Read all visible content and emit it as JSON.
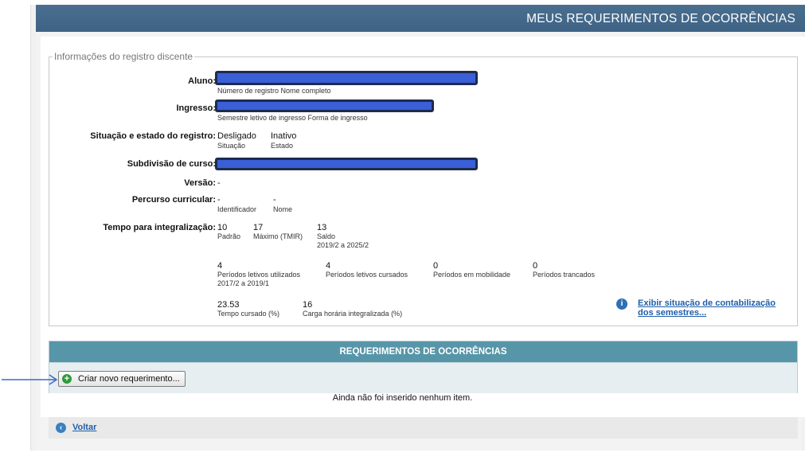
{
  "header": {
    "title": "MEUS REQUERIMENTOS DE OCORRÊNCIAS"
  },
  "registro": {
    "legend": "Informações do registro discente",
    "aluno": {
      "label": "Aluno:",
      "sub": "Número de registro   Nome completo"
    },
    "ingresso": {
      "label": "Ingresso:",
      "sub": "Semestre letivo de ingresso   Forma de ingresso"
    },
    "situacao": {
      "label": "Situação e estado do registro:",
      "situacao_value": "Desligado",
      "situacao_sub": "Situação",
      "estado_value": "Inativo",
      "estado_sub": "Estado"
    },
    "subdivisao": {
      "label": "Subdivisão de curso:"
    },
    "versao": {
      "label": "Versão:",
      "value": "-"
    },
    "percurso": {
      "label": "Percurso curricular:",
      "identificador_value": "-",
      "identificador_sub": "Identificador",
      "nome_value": "-",
      "nome_sub": "Nome"
    },
    "tempo": {
      "label": "Tempo para integralização:",
      "padrao_value": "10",
      "padrao_sub": "Padrão",
      "maximo_value": "17",
      "maximo_sub": "Máximo (TMIR)",
      "saldo_value": "13",
      "saldo_sub": "Saldo",
      "saldo_range": "2019/2 a 2025/2"
    },
    "periodos": {
      "utilizados_value": "4",
      "utilizados_sub": "Períodos letivos utilizados",
      "utilizados_range": "2017/2 a 2019/1",
      "cursados_value": "4",
      "cursados_sub": "Períodos letivos cursados",
      "mobilidade_value": "0",
      "mobilidade_sub": "Períodos em mobilidade",
      "trancados_value": "0",
      "trancados_sub": "Períodos trancados"
    },
    "carga": {
      "tempo_cursado_value": "23.53",
      "tempo_cursado_sub": "Tempo cursado (%)",
      "carga_value": "16",
      "carga_sub": "Carga horária integralizada (%)"
    },
    "info_link": "Exibir situação de contabilização dos semestres..."
  },
  "requerimentos": {
    "header": "REQUERIMENTOS DE OCORRÊNCIAS",
    "criar_label": "Criar novo requerimento...",
    "empty_message": "Ainda não foi inserido nenhum item."
  },
  "footer": {
    "voltar_label": "Voltar"
  },
  "colors": {
    "header_bg": "#4a6e8f",
    "section_header_bg": "#5796a8",
    "link": "#1f5ea8",
    "redaction": "#3a5fd6",
    "annotation_arrow": "#3b6bbf"
  }
}
